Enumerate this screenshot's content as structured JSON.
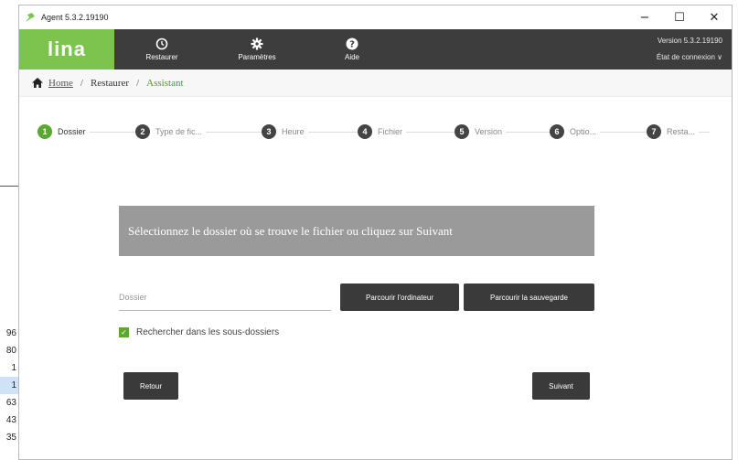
{
  "background": {
    "numbers": [
      "96",
      "80",
      "1",
      "1",
      "63",
      "43",
      "35"
    ]
  },
  "window": {
    "title": "Agent 5.3.2.19190",
    "controls": {
      "minimize": "−",
      "maximize": "☐",
      "close": "✕"
    }
  },
  "topbar": {
    "logo": "lina",
    "nav": [
      {
        "label": "Restaurer",
        "icon": "history-icon"
      },
      {
        "label": "Paramètres",
        "icon": "gear-icon"
      },
      {
        "label": "Aide",
        "icon": "help-icon"
      }
    ],
    "version": "Version 5.3.2.19190",
    "connection": "État de connexion ∨"
  },
  "breadcrumb": {
    "home": "Home",
    "restore": "Restaurer",
    "current": "Assistant"
  },
  "steps": [
    {
      "num": "1",
      "label": "Dossier",
      "active": true
    },
    {
      "num": "2",
      "label": "Type de fic...",
      "active": false
    },
    {
      "num": "3",
      "label": "Heure",
      "active": false
    },
    {
      "num": "4",
      "label": "Fichier",
      "active": false
    },
    {
      "num": "5",
      "label": "Version",
      "active": false
    },
    {
      "num": "6",
      "label": "Optio...",
      "active": false
    },
    {
      "num": "7",
      "label": "Resta...",
      "active": false
    }
  ],
  "main": {
    "banner": "Sélectionnez le dossier où se trouve le fichier ou cliquez sur Suivant",
    "folder_placeholder": "Dossier",
    "browse_computer": "Parcourir l'ordinateur",
    "browse_backup": "Parcourir la sauvegarde",
    "subfolders_label": "Rechercher dans les sous-dossiers",
    "subfolders_checked": true,
    "back": "Retour",
    "next": "Suivant"
  },
  "colors": {
    "accent": "#5aa830",
    "logo_bg": "#7cc44d",
    "topbar": "#3d3d3d",
    "banner": "#9a9a9a"
  }
}
